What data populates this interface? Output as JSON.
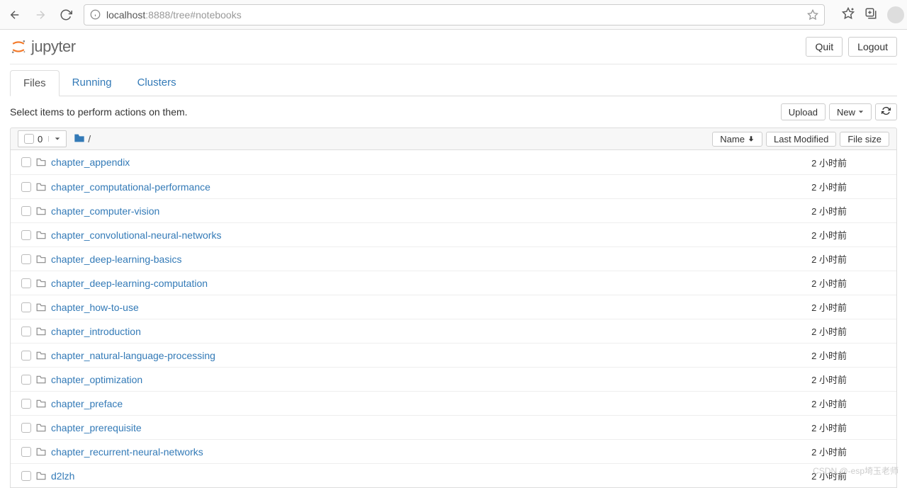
{
  "browser": {
    "url_dim_prefix": "localhost",
    "url_port": ":8888",
    "url_path": "/tree#notebooks"
  },
  "header": {
    "logo_text": "jupyter",
    "quit": "Quit",
    "logout": "Logout"
  },
  "tabs": [
    {
      "label": "Files",
      "active": true
    },
    {
      "label": "Running",
      "active": false
    },
    {
      "label": "Clusters",
      "active": false
    }
  ],
  "toolbar": {
    "hint": "Select items to perform actions on them.",
    "upload": "Upload",
    "new": "New",
    "refresh_icon": "refresh-icon"
  },
  "list_header": {
    "selected_count": "0",
    "breadcrumb_root": "/",
    "sort_name": "Name",
    "sort_modified": "Last Modified",
    "sort_size": "File size"
  },
  "files": [
    {
      "type": "folder",
      "name": "chapter_appendix",
      "modified": "2 小时前",
      "size": ""
    },
    {
      "type": "folder",
      "name": "chapter_computational-performance",
      "modified": "2 小时前",
      "size": ""
    },
    {
      "type": "folder",
      "name": "chapter_computer-vision",
      "modified": "2 小时前",
      "size": ""
    },
    {
      "type": "folder",
      "name": "chapter_convolutional-neural-networks",
      "modified": "2 小时前",
      "size": ""
    },
    {
      "type": "folder",
      "name": "chapter_deep-learning-basics",
      "modified": "2 小时前",
      "size": ""
    },
    {
      "type": "folder",
      "name": "chapter_deep-learning-computation",
      "modified": "2 小时前",
      "size": ""
    },
    {
      "type": "folder",
      "name": "chapter_how-to-use",
      "modified": "2 小时前",
      "size": ""
    },
    {
      "type": "folder",
      "name": "chapter_introduction",
      "modified": "2 小时前",
      "size": ""
    },
    {
      "type": "folder",
      "name": "chapter_natural-language-processing",
      "modified": "2 小时前",
      "size": ""
    },
    {
      "type": "folder",
      "name": "chapter_optimization",
      "modified": "2 小时前",
      "size": ""
    },
    {
      "type": "folder",
      "name": "chapter_preface",
      "modified": "2 小时前",
      "size": ""
    },
    {
      "type": "folder",
      "name": "chapter_prerequisite",
      "modified": "2 小时前",
      "size": ""
    },
    {
      "type": "folder",
      "name": "chapter_recurrent-neural-networks",
      "modified": "2 小时前",
      "size": ""
    },
    {
      "type": "folder",
      "name": "d2lzh",
      "modified": "2 小时前",
      "size": ""
    }
  ],
  "watermark": "CSDN @-esp埼玉老师"
}
